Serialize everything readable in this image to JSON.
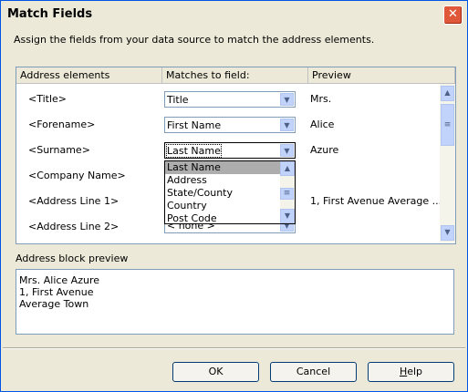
{
  "window": {
    "title": "Match Fields",
    "close_symbol": "✕"
  },
  "instruction": "Assign the fields from your data source to match the address elements.",
  "grid": {
    "headers": {
      "address": "Address elements",
      "matches": "Matches to field:",
      "preview": "Preview"
    },
    "rows": [
      {
        "element": "<Title>",
        "field": "Title",
        "preview": "Mrs."
      },
      {
        "element": "<Forename>",
        "field": "First Name",
        "preview": "Alice"
      },
      {
        "element": "<Surname>",
        "field": "Last Name",
        "preview": "Azure"
      },
      {
        "element": "<Company Name>",
        "field": "",
        "preview": ""
      },
      {
        "element": "<Address Line 1>",
        "field": "",
        "preview": "1, First Avenue Average ..."
      },
      {
        "element": "<Address Line 2>",
        "field": "< none >",
        "preview": ""
      }
    ],
    "dropdown_options": [
      "Last Name",
      "Address",
      "State/County",
      "Country",
      "Post Code"
    ],
    "dropdown_selected": "Last Name"
  },
  "address_block": {
    "label": "Address block preview",
    "lines": [
      "Mrs. Alice Azure",
      "1, First Avenue",
      "Average Town"
    ]
  },
  "buttons": {
    "ok": "OK",
    "cancel": "Cancel",
    "help_prefix": "",
    "help_mnemonic": "H",
    "help_rest": "elp"
  },
  "icons": {
    "down_arrow": "▼",
    "up_arrow": "▲",
    "grip": "≡"
  }
}
